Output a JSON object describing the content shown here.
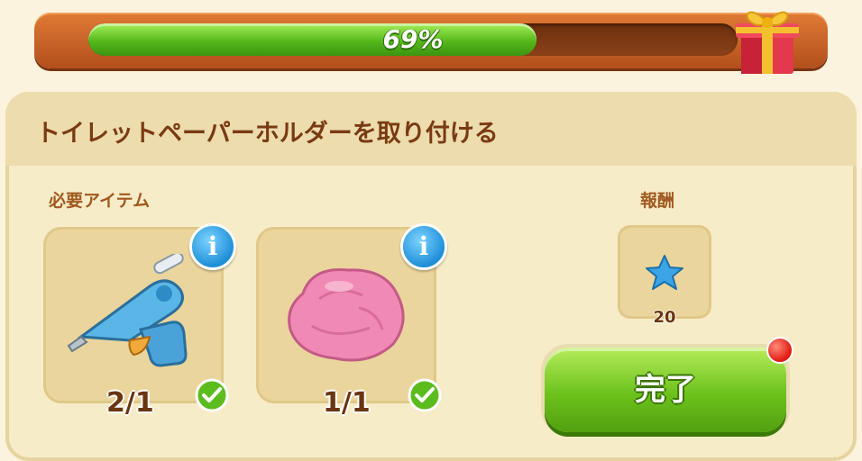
{
  "progress": {
    "value": 0.69,
    "label": "69%"
  },
  "task": {
    "title": "トイレットペーパーホルダーを取り付ける"
  },
  "required": {
    "label": "必要アイテム",
    "items": [
      {
        "icon": "glue-gun-icon",
        "count": "2/1",
        "complete": true
      },
      {
        "icon": "pink-putty-icon",
        "count": "1/1",
        "complete": true
      }
    ]
  },
  "reward": {
    "label": "報酬",
    "icon": "blue-star-icon",
    "amount": "20"
  },
  "complete_button": {
    "label": "完了"
  },
  "colors": {
    "accent_green": "#6cc21c",
    "header_orange": "#e07a35",
    "title_brown": "#7a3a12"
  }
}
